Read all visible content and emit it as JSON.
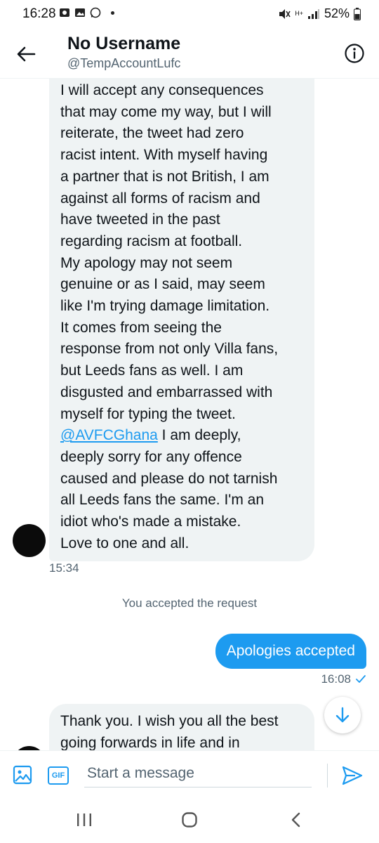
{
  "status_bar": {
    "time": "16:28",
    "battery": "52%",
    "network": "H+"
  },
  "header": {
    "title": "No Username",
    "handle": "@TempAccountLufc"
  },
  "messages": {
    "first": {
      "lines_before": [
        "I will accept any consequences",
        "that may come my way, but I will",
        "reiterate, the tweet had zero",
        "racist intent. With myself having",
        "a partner that is not British, I am",
        "against all forms of racism and",
        "have tweeted in the past",
        "regarding racism at football.",
        "My apology may not seem",
        "genuine or as I said, may seem",
        "like I'm trying damage limitation.",
        "It comes from seeing the",
        "response from not only Villa fans,",
        "but Leeds fans as well. I am",
        "disgusted and embarrassed with",
        "myself for typing the tweet."
      ],
      "mention": "@AVFCGhana",
      "mention_rest": " I am deeply,",
      "lines_after": [
        "deeply sorry for any offence",
        "caused and please do not tarnish",
        "all Leeds fans the same. I'm an",
        "idiot who's made a mistake.",
        "Love to one and all."
      ],
      "time": "15:34"
    },
    "system": "You accepted the request",
    "outgoing": {
      "text": "Apologies accepted",
      "time": "16:08"
    },
    "second": {
      "lines": [
        "Thank you. I wish you all the best",
        "going forwards in life and in"
      ]
    }
  },
  "compose": {
    "placeholder": "Start a message",
    "gif_label": "GIF"
  },
  "colors": {
    "accent": "#1d9bf0",
    "bubble_in": "#eff3f4",
    "secondary_text": "#536471"
  }
}
